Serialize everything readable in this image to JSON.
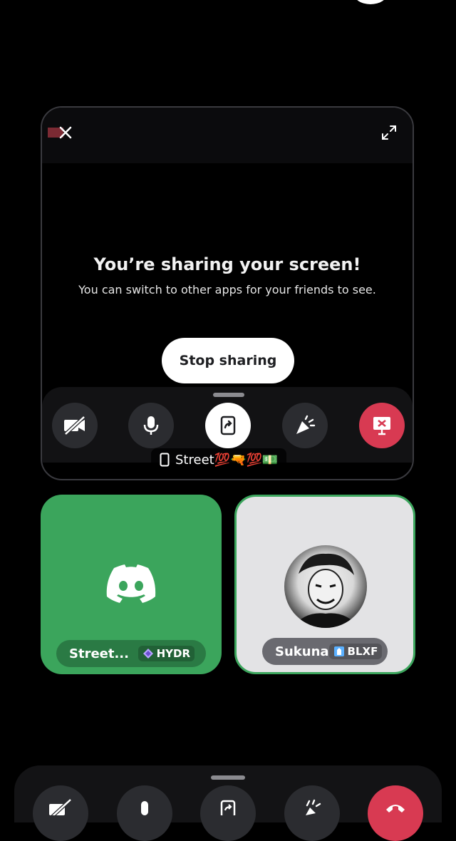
{
  "share": {
    "title": "You’re sharing your screen!",
    "subtitle": "You can switch to other apps for your friends to see.",
    "stop_label": "Stop sharing",
    "name_tag": "Street💯🔫💯💵"
  },
  "card_controls": [
    {
      "icon": "video-off-icon"
    },
    {
      "icon": "microphone-icon"
    },
    {
      "icon": "screen-share-icon"
    },
    {
      "icon": "soundboard-icon"
    },
    {
      "icon": "stop-stream-icon"
    }
  ],
  "tiles": [
    {
      "name": "Street...",
      "tag": "HYDR",
      "tag_icon": "diamond-icon",
      "color": "#3ba55c"
    },
    {
      "name": "Sukuna",
      "tag": "BLXF",
      "tag_icon": "tower-icon",
      "color": "#e3e3e5"
    }
  ],
  "bottom_controls": [
    {
      "icon": "video-off-icon"
    },
    {
      "icon": "microphone-icon"
    },
    {
      "icon": "screen-share-icon"
    },
    {
      "icon": "soundboard-icon"
    },
    {
      "icon": "end-call-icon"
    }
  ],
  "colors": {
    "accent_green": "#3ba55c",
    "danger_red": "#d83a52",
    "background": "#000000"
  }
}
